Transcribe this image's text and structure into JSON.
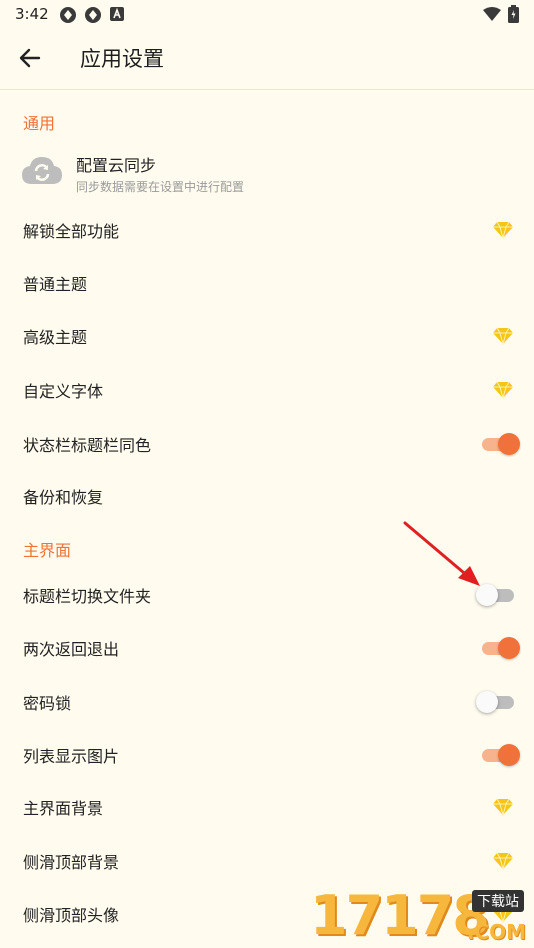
{
  "status_bar": {
    "time": "3:42"
  },
  "app_bar": {
    "title": "应用设置"
  },
  "sections": {
    "general": "通用",
    "main_interface": "主界面"
  },
  "cloud_sync": {
    "title": "配置云同步",
    "subtitle": "同步数据需要在设置中进行配置"
  },
  "rows": [
    {
      "label": "解锁全部功能",
      "control": "gem"
    },
    {
      "label": "普通主题",
      "control": "none"
    },
    {
      "label": "高级主题",
      "control": "gem"
    },
    {
      "label": "自定义字体",
      "control": "gem"
    },
    {
      "label": "状态栏标题栏同色",
      "control": "toggle",
      "on": true
    },
    {
      "label": "备份和恢复",
      "control": "none"
    },
    {
      "label": "标题栏切换文件夹",
      "control": "toggle",
      "on": false
    },
    {
      "label": "两次返回退出",
      "control": "toggle",
      "on": true
    },
    {
      "label": "密码锁",
      "control": "toggle",
      "on": false
    },
    {
      "label": "列表显示图片",
      "control": "toggle",
      "on": true
    },
    {
      "label": "主界面背景",
      "control": "gem"
    },
    {
      "label": "侧滑顶部背景",
      "control": "gem"
    },
    {
      "label": "侧滑顶部头像",
      "control": "gem"
    }
  ],
  "watermark": {
    "digits": "17178",
    "tag": "下载站",
    "domain": ".COM"
  },
  "colors": {
    "accent": "#F0723A",
    "gem": "#F5C518",
    "background": "#FFFCEF"
  },
  "icons": [
    "back-arrow-icon",
    "cloud-sync-icon",
    "diamond-icon",
    "wifi-icon",
    "battery-icon"
  ]
}
